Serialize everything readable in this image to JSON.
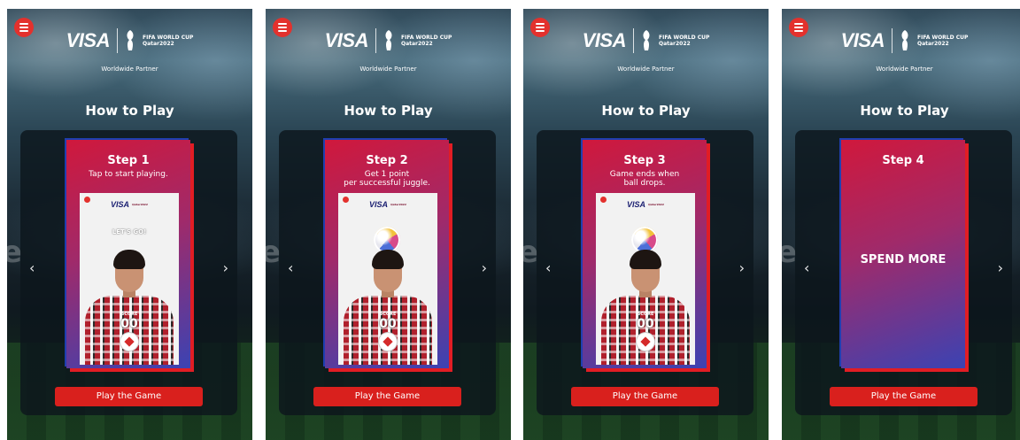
{
  "app": {
    "brand": "VISA",
    "fifa_line1": "FIFA WORLD CUP",
    "fifa_line2": "Qatar2022",
    "partner": "Worldwide Partner",
    "how_to_play": "How to Play",
    "play_button": "Play the Game"
  },
  "screens": [
    {
      "step": "Step 1",
      "desc_line1": "Tap to start playing.",
      "desc_line2": "",
      "preview": {
        "visa": "VISA",
        "letsgo": "LET'S GO!",
        "score_label": "SCORE",
        "score": "00"
      }
    },
    {
      "step": "Step 2",
      "desc_line1": "Get 1 point",
      "desc_line2": "per successful juggle.",
      "preview": {
        "visa": "VISA",
        "score_label": "SCORE",
        "score": "00"
      }
    },
    {
      "step": "Step 3",
      "desc_line1": "Game ends when",
      "desc_line2": "ball drops.",
      "preview": {
        "visa": "VISA",
        "score_label": "SCORE",
        "score": "00"
      }
    },
    {
      "step": "Step 4",
      "spend_more": "SPEND MORE"
    }
  ],
  "icons": {
    "menu": "hamburger-menu-icon",
    "left": "chevron-left-icon",
    "right": "chevron-right-icon"
  },
  "colors": {
    "accent_red": "#d9201d",
    "card_top": "#d0183c",
    "card_bottom": "#3b43b3"
  }
}
